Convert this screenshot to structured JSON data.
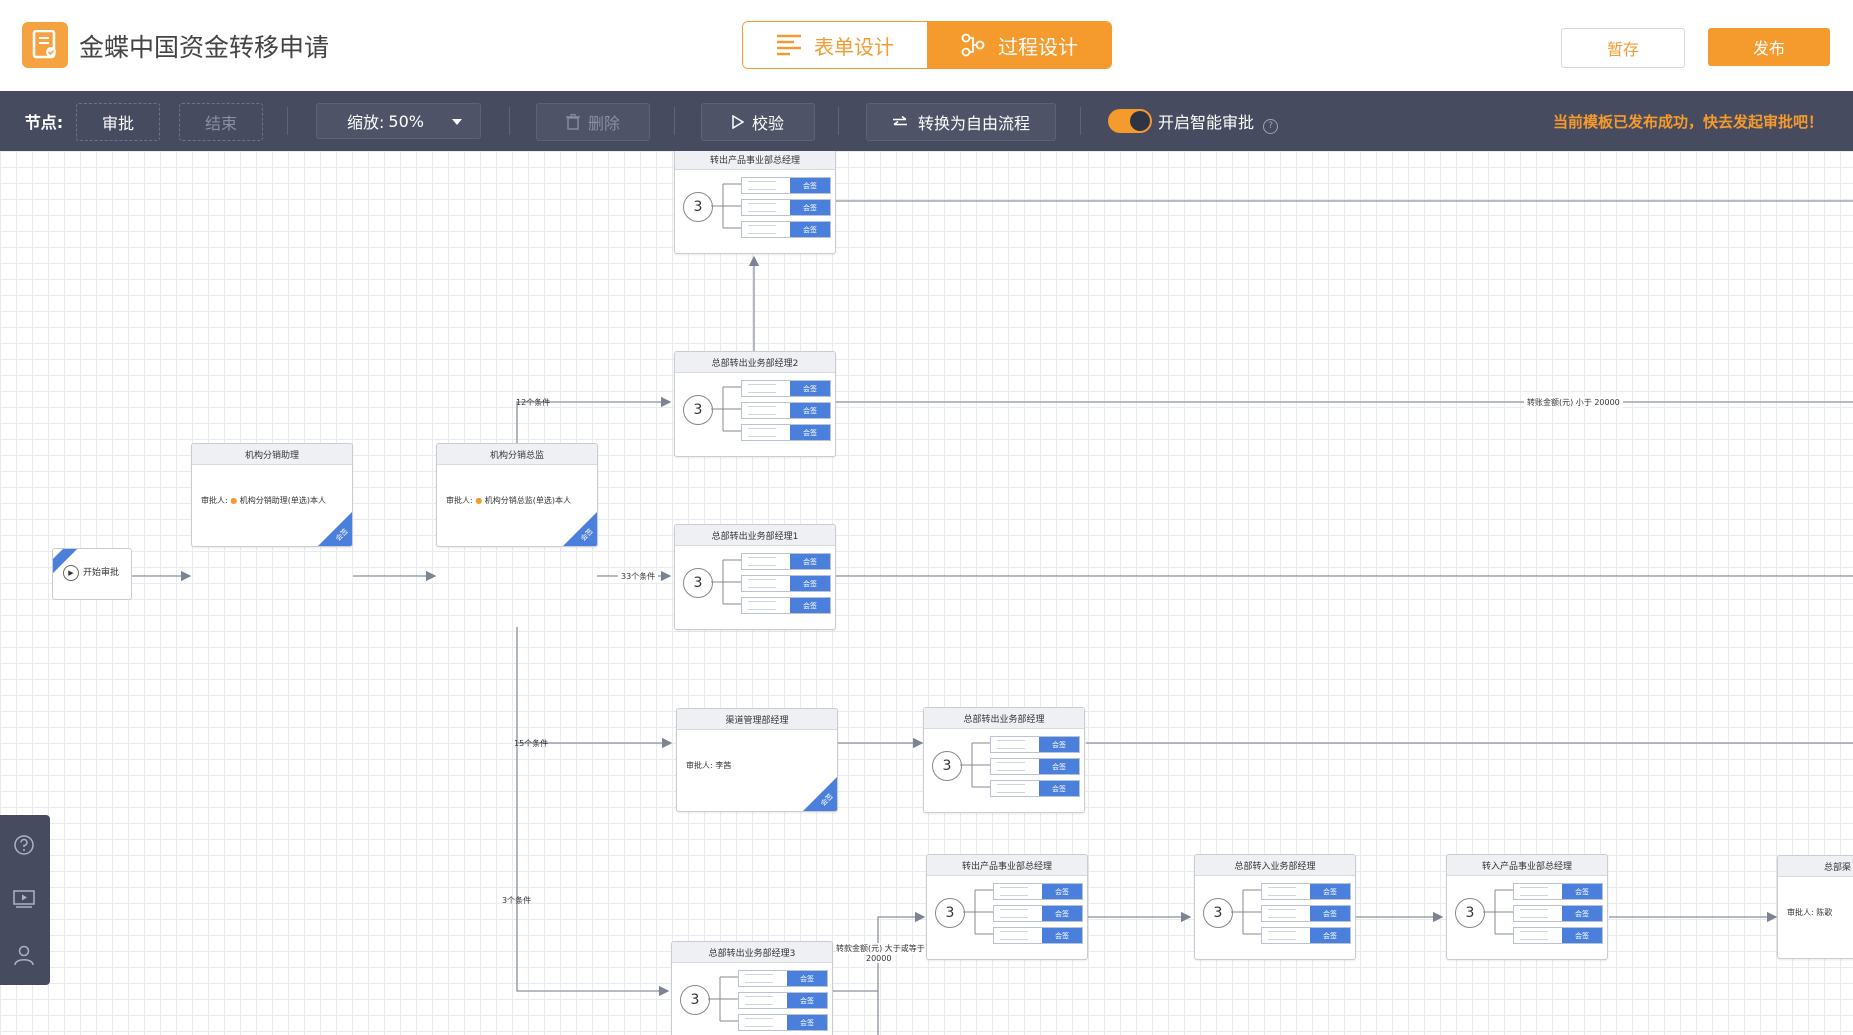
{
  "header": {
    "app_title": "金蝶中国资金转移申请",
    "tabs": [
      {
        "label": "表单设计",
        "active": false
      },
      {
        "label": "过程设计",
        "active": true
      }
    ],
    "save_label": "暂存",
    "publish_label": "发布"
  },
  "toolbar": {
    "node_label": "节点:",
    "approve_label": "审批",
    "end_label": "结束",
    "zoom_label": "缩放:",
    "zoom_value": "50%",
    "delete_label": "删除",
    "validate_label": "校验",
    "convert_label": "转换为自由流程",
    "smart_label": "开启智能审批",
    "smart_enabled": true,
    "notice": "当前模板已发布成功，快去发起审批吧！"
  },
  "flow": {
    "start_label": "开始审批",
    "tag_label": "会签",
    "approver_prefix": "审批人:",
    "count": "3",
    "nodes": {
      "n1": {
        "title": "机构分销助理",
        "approver": "机构分销助理(单选)本人"
      },
      "n2": {
        "title": "机构分销总监",
        "approver": "机构分销总监(单选)本人"
      },
      "n3": {
        "title": "转出产品事业部总经理"
      },
      "n4": {
        "title": "总部转出业务部经理2"
      },
      "n5": {
        "title": "总部转出业务部经理1"
      },
      "n6": {
        "title": "渠道管理部经理",
        "approver": "李茜"
      },
      "n7": {
        "title": "总部转出业务部经理"
      },
      "n8": {
        "title": "总部转出业务部经理3"
      },
      "n9": {
        "title": "转出产品事业部总经理"
      },
      "n10": {
        "title": "总部转入业务部经理"
      },
      "n11": {
        "title": "转入产品事业部总经理"
      },
      "n12": {
        "title": "总部渠",
        "approver": "陈歌"
      }
    },
    "conditions": {
      "c12": "12个条件",
      "c33": "33个条件",
      "c15": "15个条件",
      "c3": "3个条件",
      "amount_lt": "转账金额(元) 小于 20000",
      "amount_ge_1": "转款金额(元) 大于或等于",
      "amount_ge_2": "20000"
    }
  },
  "side_icons": [
    "help-icon",
    "video-icon",
    "user-icon"
  ]
}
